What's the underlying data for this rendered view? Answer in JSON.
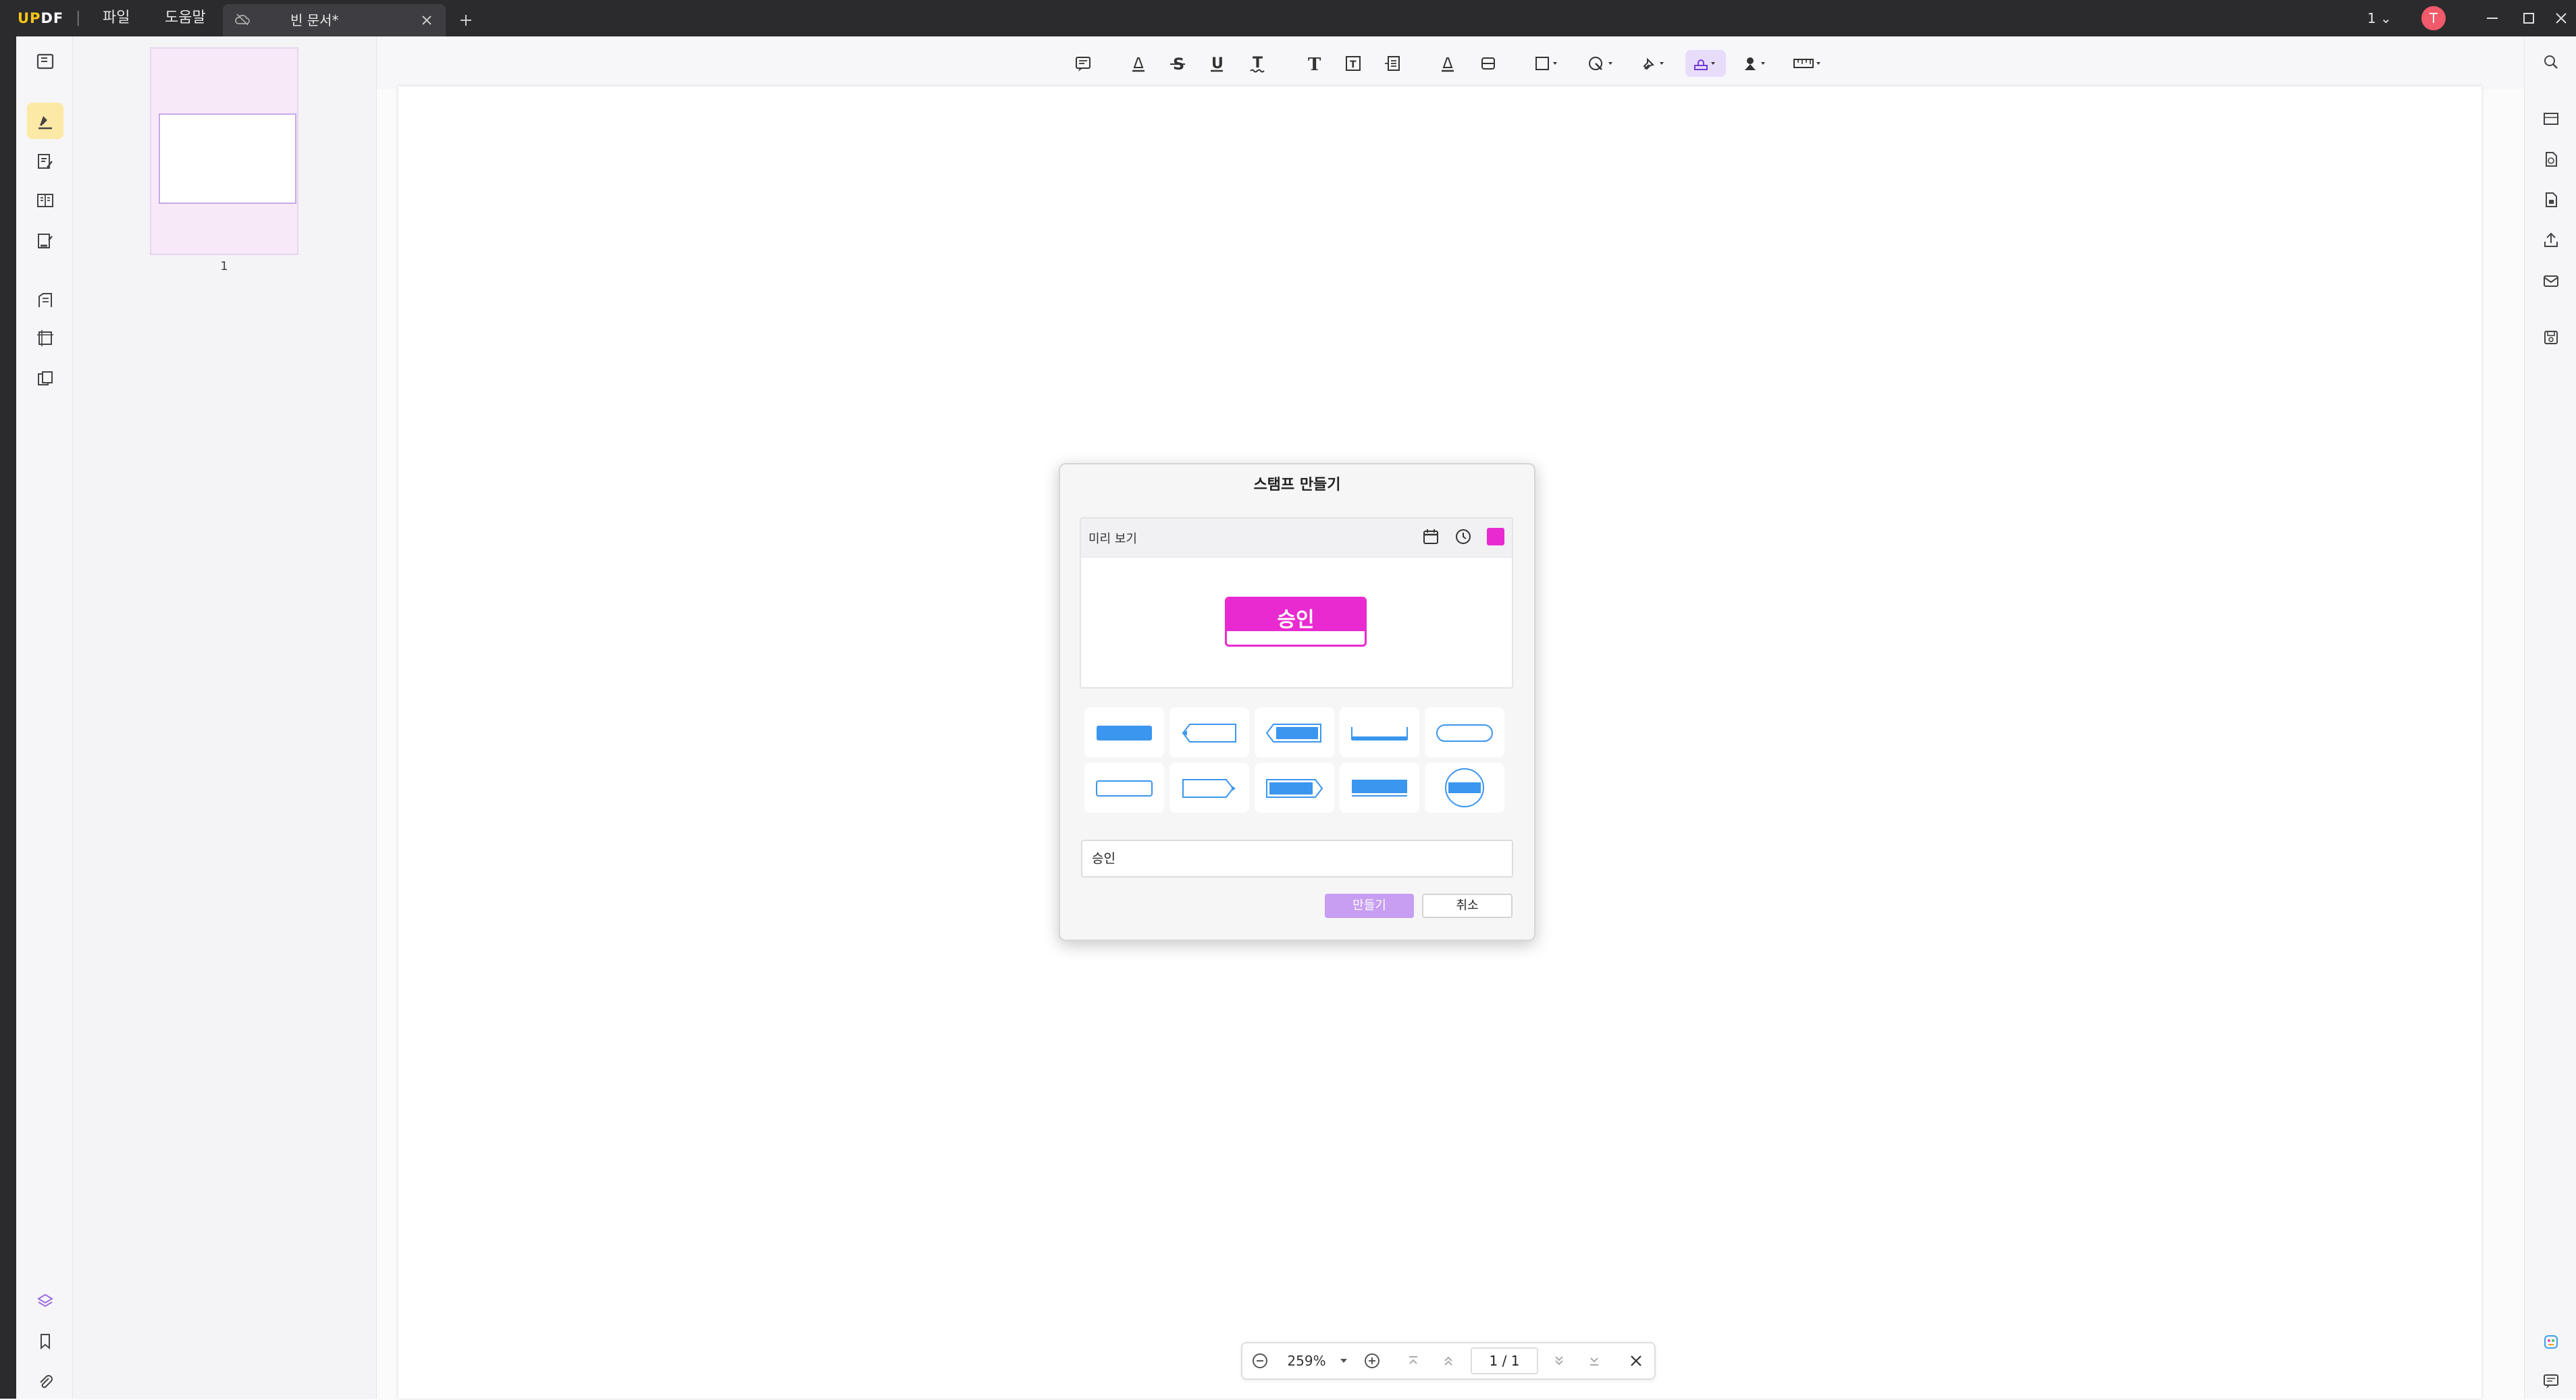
{
  "titlebar": {
    "logo_part1": "UP",
    "logo_part2": "DF",
    "menu": [
      "파일",
      "도움말"
    ],
    "tab_title": "빈 문서*",
    "version_label": "1",
    "avatar_initial": "T"
  },
  "thumbnails": {
    "page_number": "1"
  },
  "dialog": {
    "title": "스탬프 만들기",
    "preview_label": "미리 보기",
    "stamp_text": "승인",
    "stamp_color": "#e82ad0",
    "text_value": "승인",
    "create_button": "만들기",
    "cancel_button": "취소",
    "shape_icons": [
      "solid-rect-shape-icon",
      "left-arrow-outline-shape-icon",
      "left-arrow-filled-shape-icon",
      "underline-shape-icon",
      "rounded-outline-shape-icon",
      "thin-outline-shape-icon",
      "right-arrow-outline-shape-icon",
      "right-arrow-filled-shape-icon",
      "solid-banner-shape-icon",
      "circle-seal-shape-icon"
    ]
  },
  "pagebar": {
    "zoom": "259%",
    "current_page": "1",
    "separator": "/",
    "total_pages": "1"
  },
  "colors": {
    "accent": "#c79ef2",
    "shape_blue": "#3a96ee",
    "titlebar": "#2b2b2e"
  }
}
